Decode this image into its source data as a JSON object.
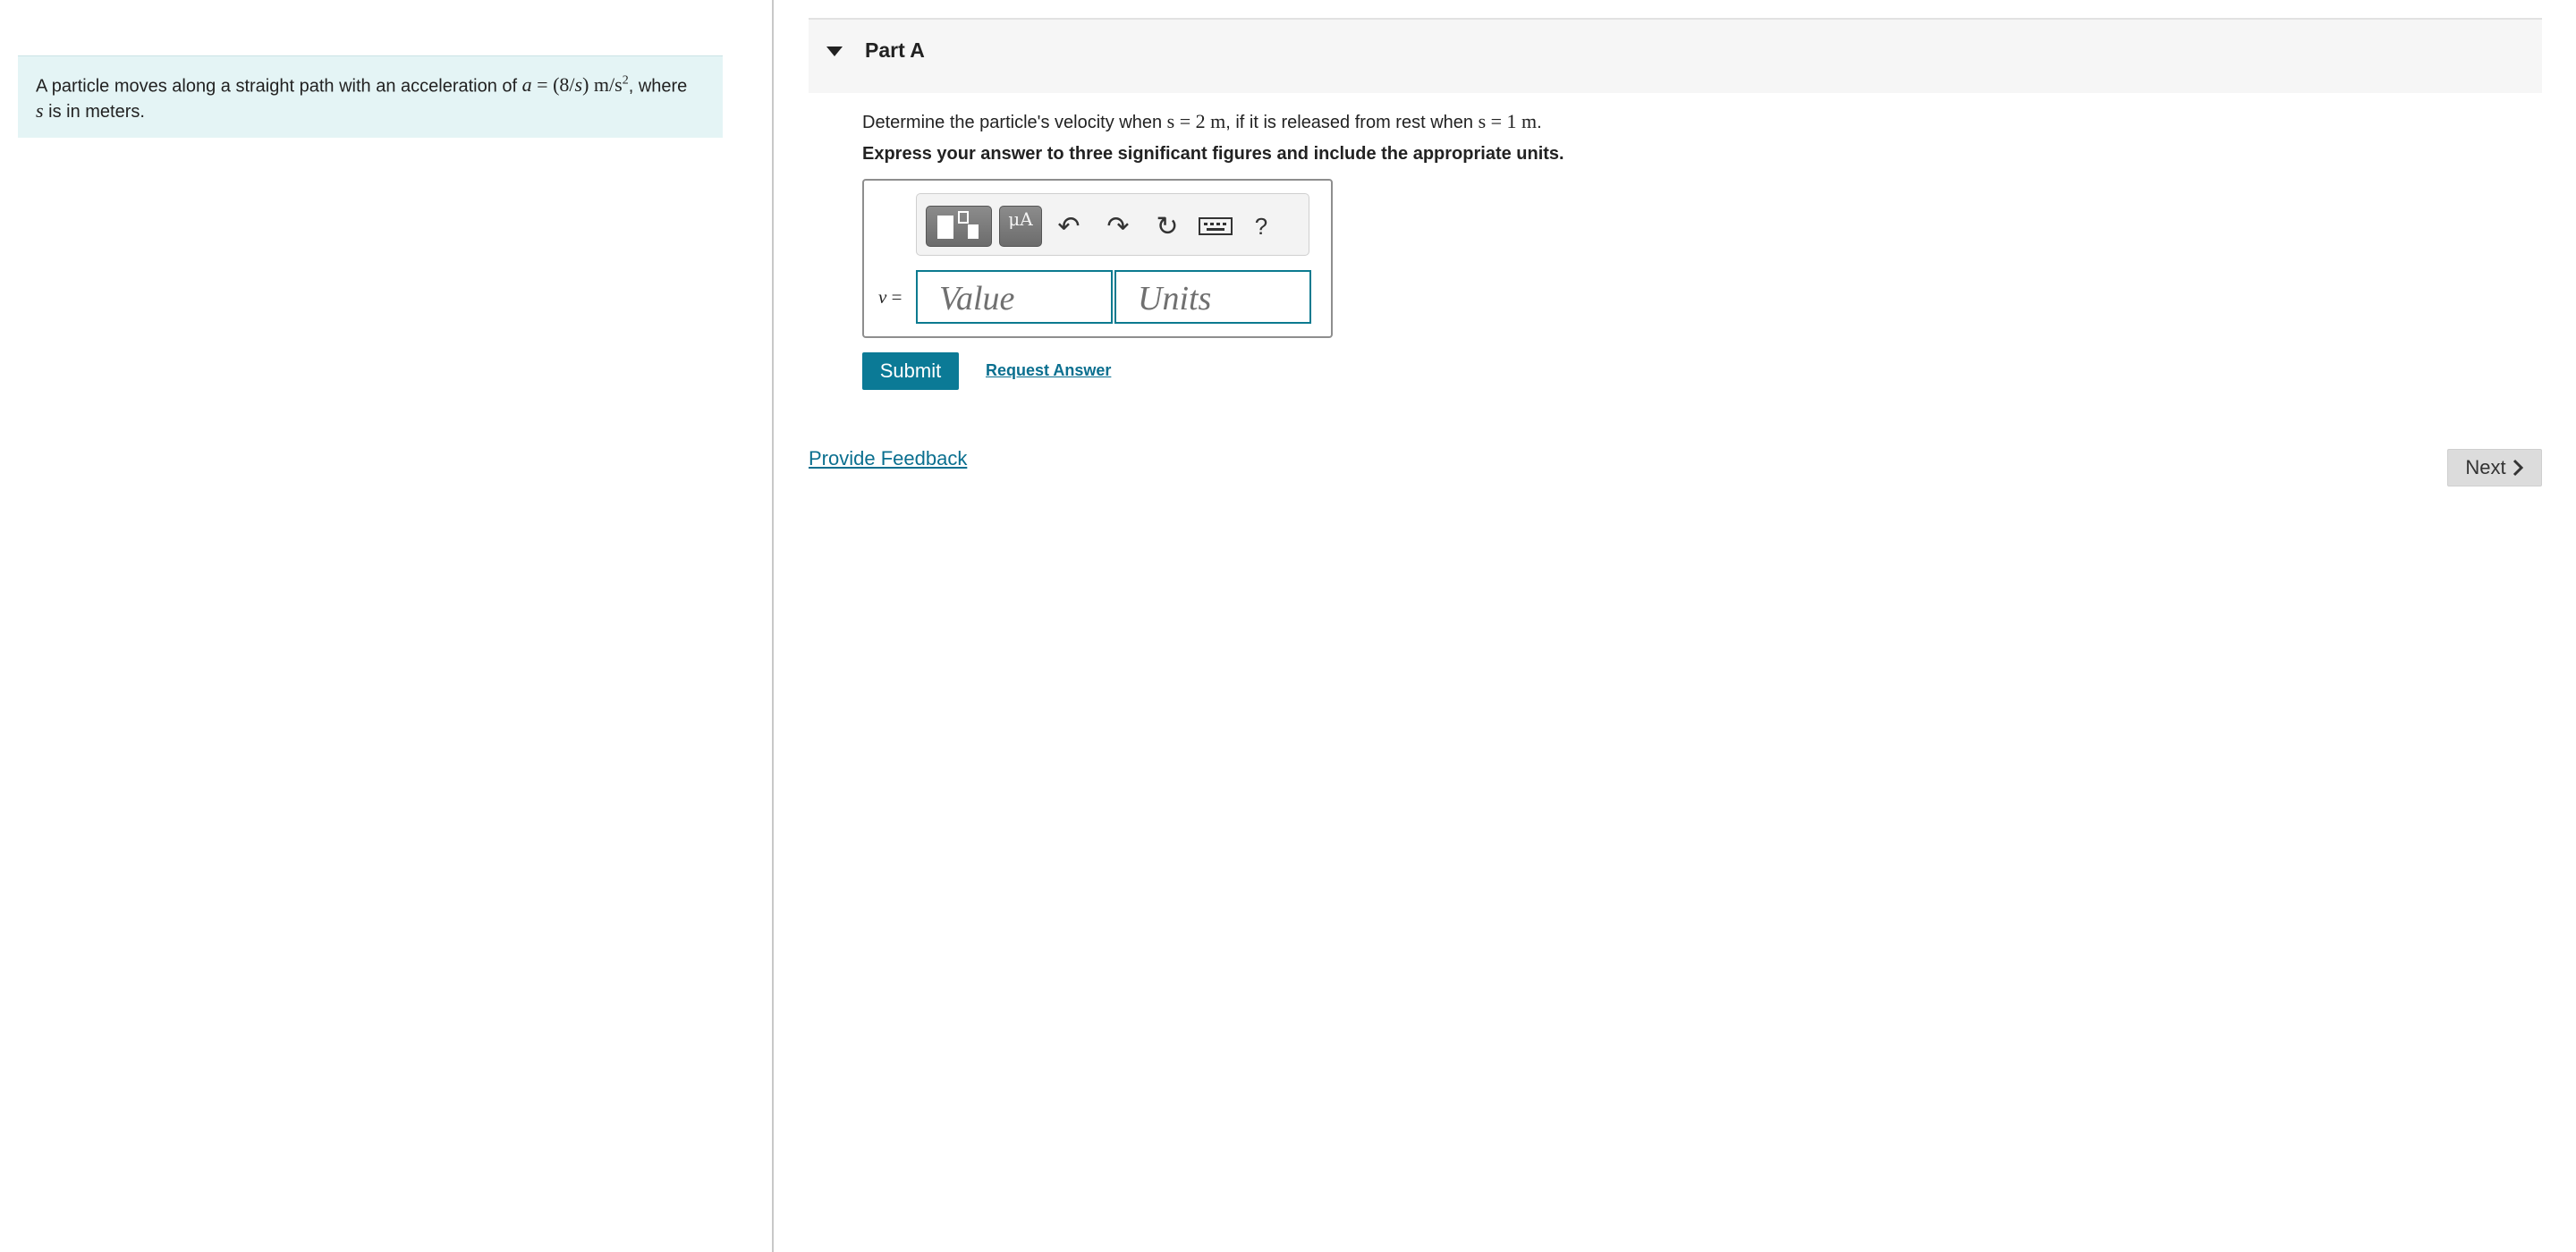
{
  "problem": {
    "text_before": "A particle moves along a straight path with an acceleration of ",
    "math_a": "a",
    "math_eq": " = (8/",
    "math_s": "s",
    "math_close": ")  m/s",
    "math_exp": "2",
    "text_after": ", where ",
    "math_s2": "s",
    "text_end": " is in meters."
  },
  "part": {
    "title": "Part A",
    "question_before": "Determine the particle's velocity when ",
    "question_math1": "s = 2 m",
    "question_mid": ", if it is released from rest when ",
    "question_math2": "s = 1 m",
    "question_end": ".",
    "instruction": "Express your answer to three significant figures and include the appropriate units."
  },
  "answer": {
    "variable": "v",
    "equals": " =",
    "value_placeholder": "Value",
    "units_placeholder": "Units",
    "symbols_label": "μA",
    "help_label": "?"
  },
  "actions": {
    "submit": "Submit",
    "request_answer": "Request Answer",
    "provide_feedback": "Provide Feedback",
    "next": "Next"
  }
}
